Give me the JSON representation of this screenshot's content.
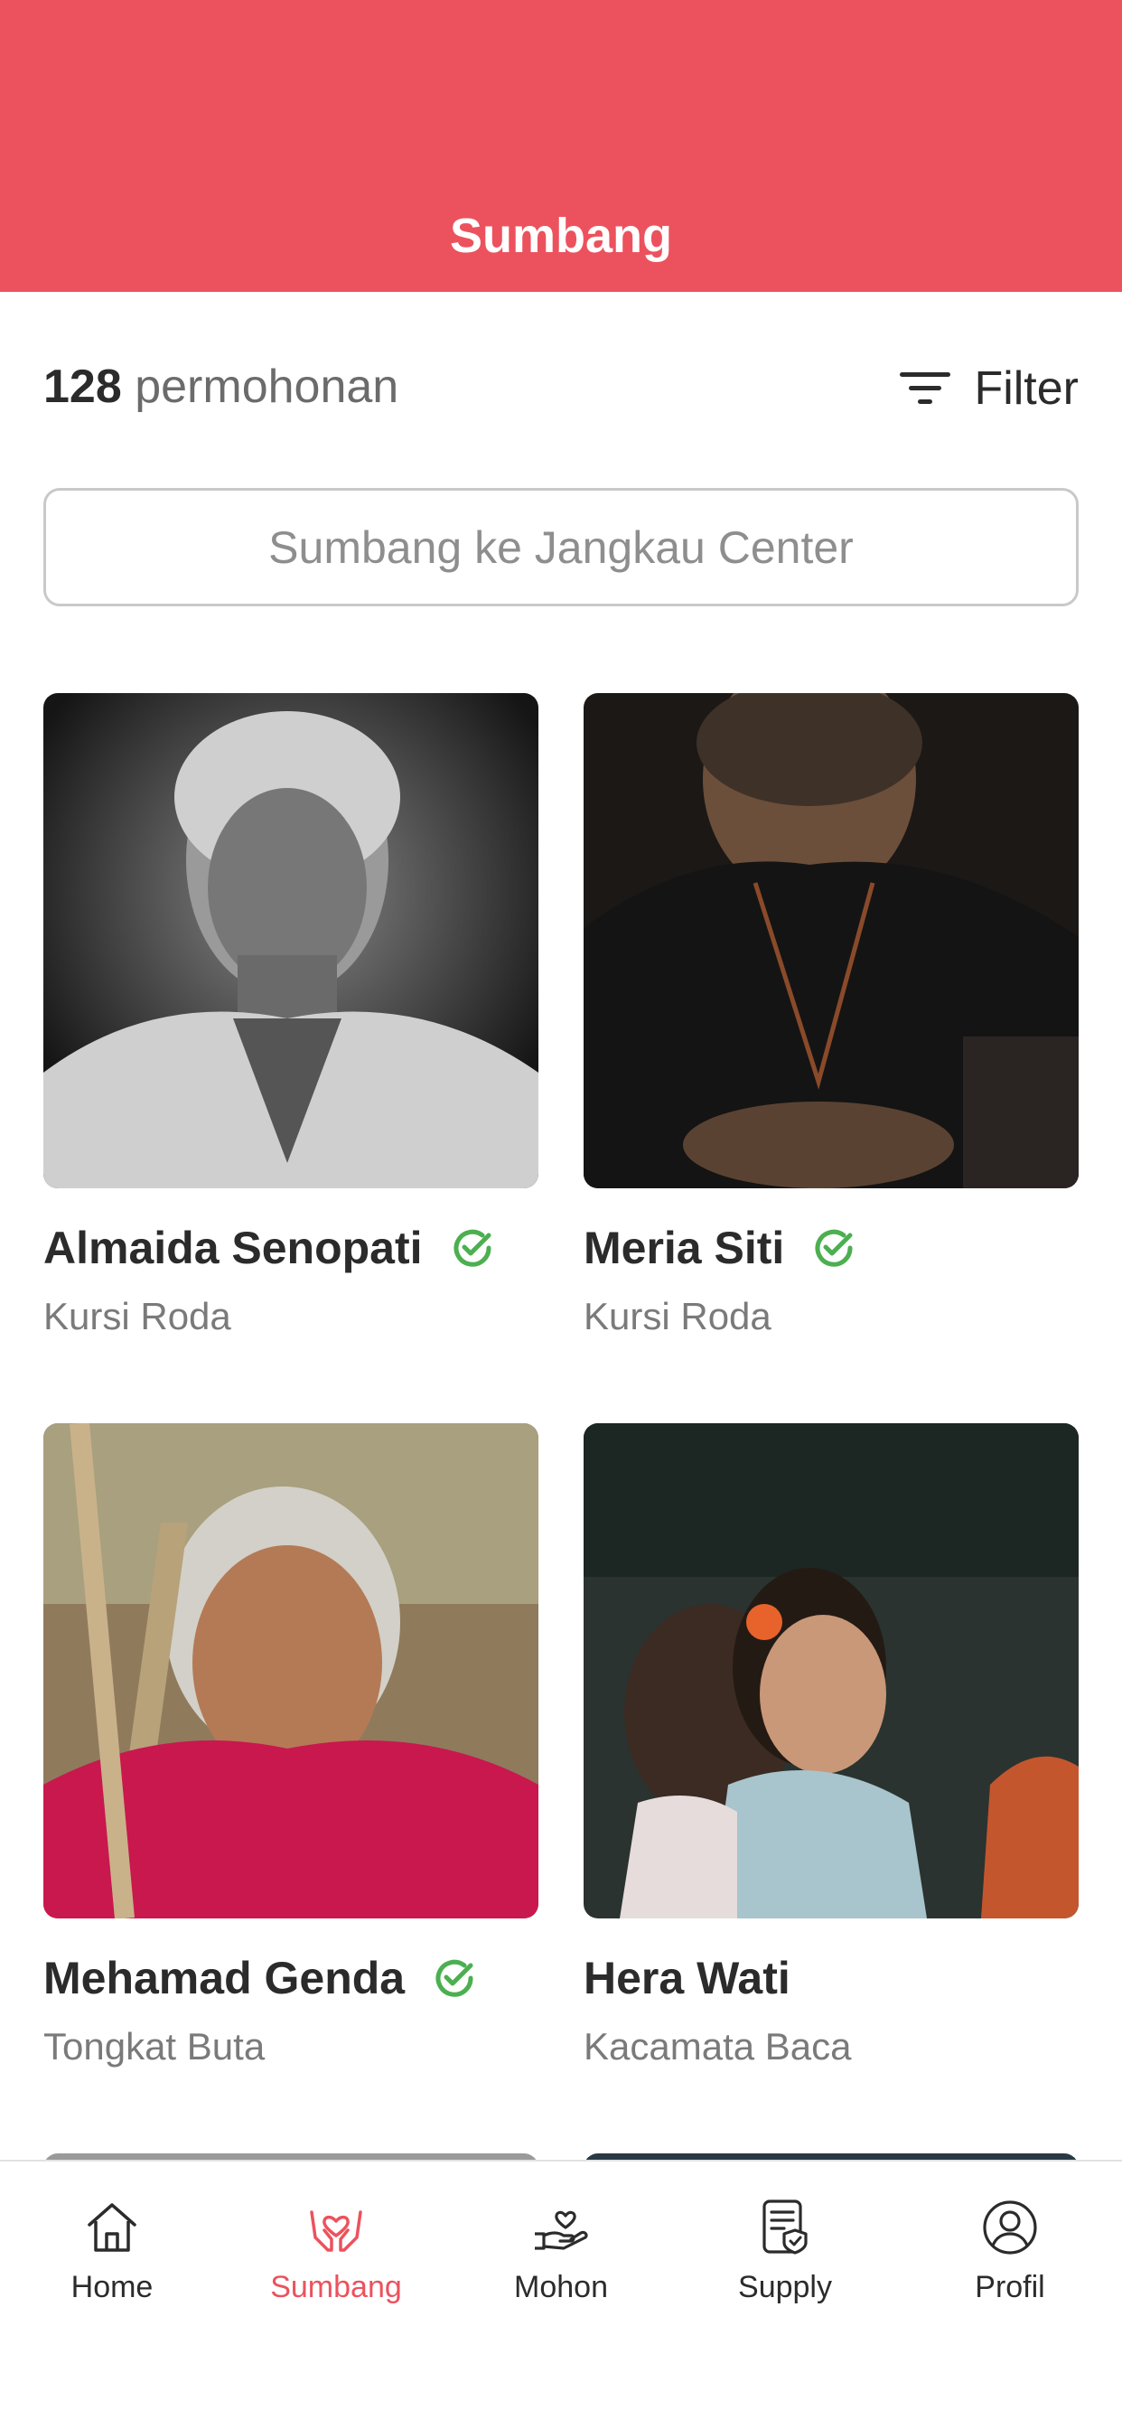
{
  "header": {
    "title": "Sumbang"
  },
  "summary": {
    "count": "128",
    "count_suffix": "permohonan"
  },
  "filter": {
    "label": "Filter",
    "icon": "filter-icon"
  },
  "center_button": {
    "label": "Sumbang ke Jangkau Center"
  },
  "cards": [
    {
      "name": "Almaida Senopati",
      "item": "Kursi Roda",
      "verified": true
    },
    {
      "name": "Meria Siti",
      "item": "Kursi Roda",
      "verified": true
    },
    {
      "name": "Mehamad Genda",
      "item": "Tongkat Buta",
      "verified": true
    },
    {
      "name": "Hera Wati",
      "item": "Kacamata Baca",
      "verified": false
    }
  ],
  "tabs": [
    {
      "label": "Home",
      "icon": "home-icon",
      "active": false
    },
    {
      "label": "Sumbang",
      "icon": "donate-hands-icon",
      "active": true
    },
    {
      "label": "Mohon",
      "icon": "request-hand-heart-icon",
      "active": false
    },
    {
      "label": "Supply",
      "icon": "supply-document-icon",
      "active": false
    },
    {
      "label": "Profil",
      "icon": "profile-icon",
      "active": false
    }
  ],
  "colors": {
    "accent": "#ec525d",
    "verified": "#4caf50",
    "text": "#2b2b2b",
    "muted": "#7a7a7a"
  }
}
